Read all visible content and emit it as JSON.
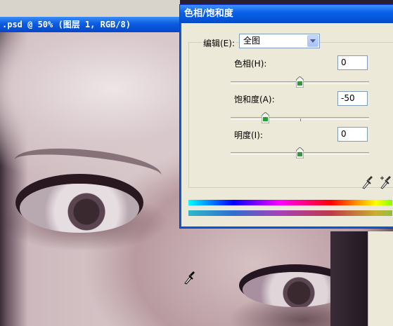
{
  "document": {
    "title": ".psd @ 50% (图层 1, RGB/8)"
  },
  "dialog": {
    "title": "色相/饱和度",
    "edit_label": "编辑(E):",
    "edit_value": "全图",
    "hue": {
      "label": "色相(H):",
      "value": "0",
      "level": 0
    },
    "saturation": {
      "label": "饱和度(A):",
      "value": "-50",
      "level": -50
    },
    "lightness": {
      "label": "明度(I):",
      "value": "0",
      "level": 0
    }
  },
  "icons": [
    "eyedropper-icon",
    "eyedropper-plus-icon",
    "dropdown-arrow-icon",
    "slider-thumb-icon",
    "cursor-eyedropper-icon"
  ],
  "colors": {
    "title_bar": "#0a5ce2",
    "dialog_bg": "#ece9d8",
    "thumb_green": "#2e9a3e"
  }
}
